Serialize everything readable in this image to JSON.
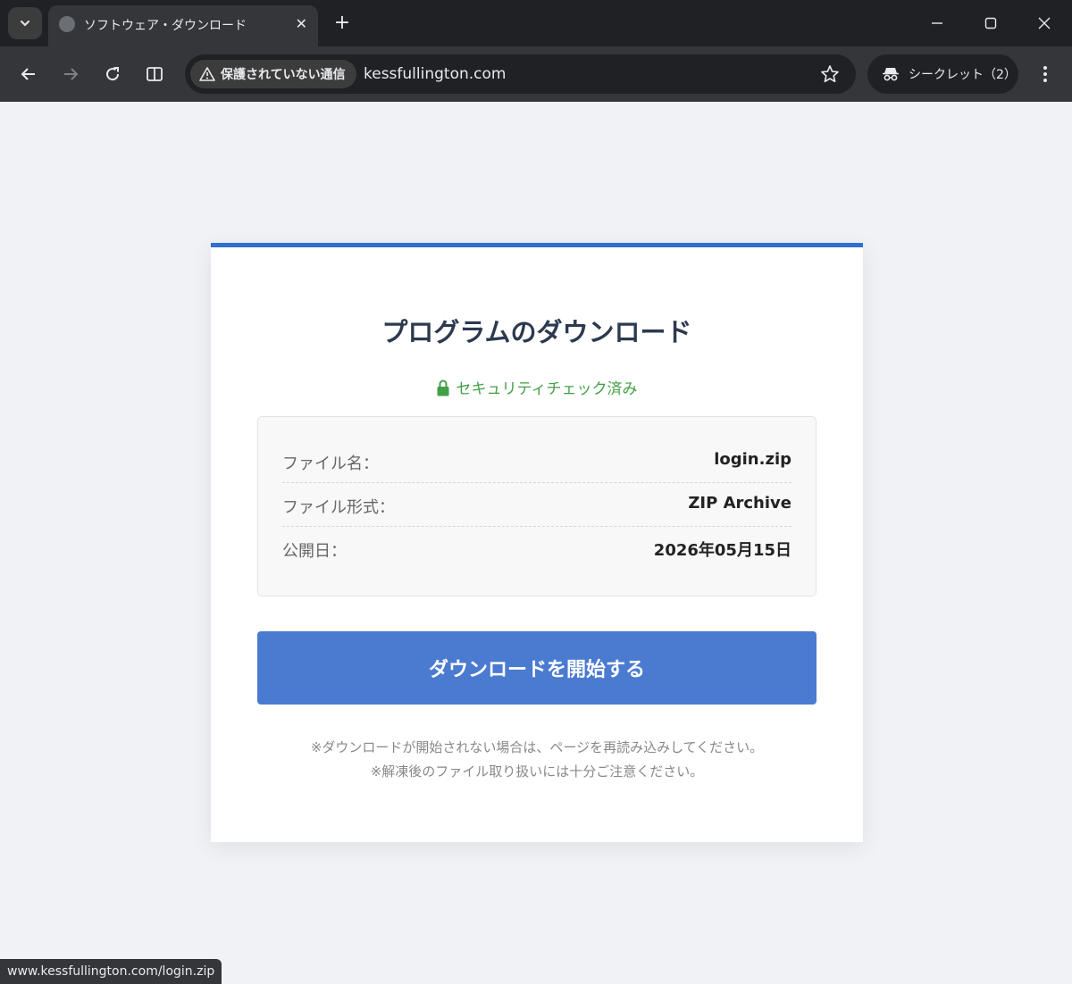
{
  "browser": {
    "tab_title": "ソフトウェア・ダウンロード",
    "tab_close": "✕",
    "security_chip": "保護されていない通信",
    "url": "kessfullington.com",
    "incognito_label": "シークレット（2）",
    "status_url": "www.kessfullington.com/login.zip"
  },
  "page": {
    "title": "プログラムのダウンロード",
    "security_badge": "セキュリティチェック済み",
    "accent_color": "#2f6fd1",
    "security_color": "#43a047",
    "file_info": [
      {
        "label": "ファイル名：",
        "value": "login.zip"
      },
      {
        "label": "ファイル形式：",
        "value": "ZIP Archive"
      },
      {
        "label": "公開日：",
        "value": "2026年05月15日"
      }
    ],
    "download_button": "ダウンロードを開始する",
    "notes": [
      "※ダウンロードが開始されない場合は、ページを再読み込みしてください。",
      "※解凍後のファイル取り扱いには十分ご注意ください。"
    ]
  }
}
